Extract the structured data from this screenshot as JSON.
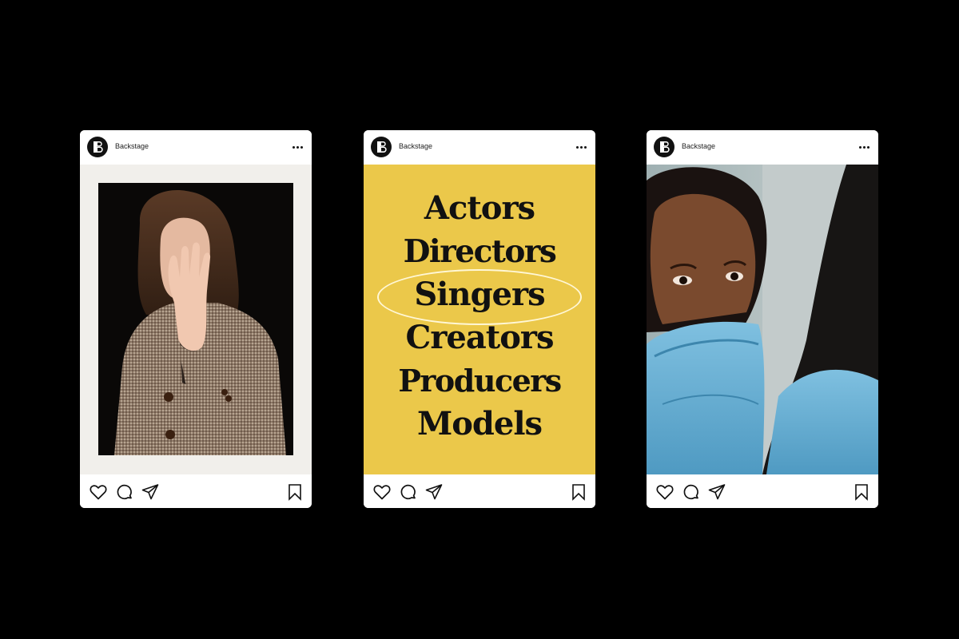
{
  "posts": [
    {
      "account": "Backstage",
      "media": "photo",
      "media_description_icon": "photo-woman-shielding-face"
    },
    {
      "account": "Backstage",
      "media": "typography",
      "words": [
        "Actors",
        "Directors",
        "Singers",
        "Creators",
        "Producers",
        "Models"
      ],
      "highlighted_word": "Singers",
      "background_color": "#ebc84a"
    },
    {
      "account": "Backstage",
      "media": "photo",
      "media_description_icon": "photo-woman-blue-hoodie"
    }
  ],
  "icons": {
    "avatar": "backstage-logo-icon",
    "more": "more-horizontal-icon",
    "like": "heart-icon",
    "comment": "comment-icon",
    "share": "send-icon",
    "save": "bookmark-icon"
  },
  "colors": {
    "page_background": "#000000",
    "card_background": "#ffffff",
    "accent_yellow": "#ebc84a"
  }
}
